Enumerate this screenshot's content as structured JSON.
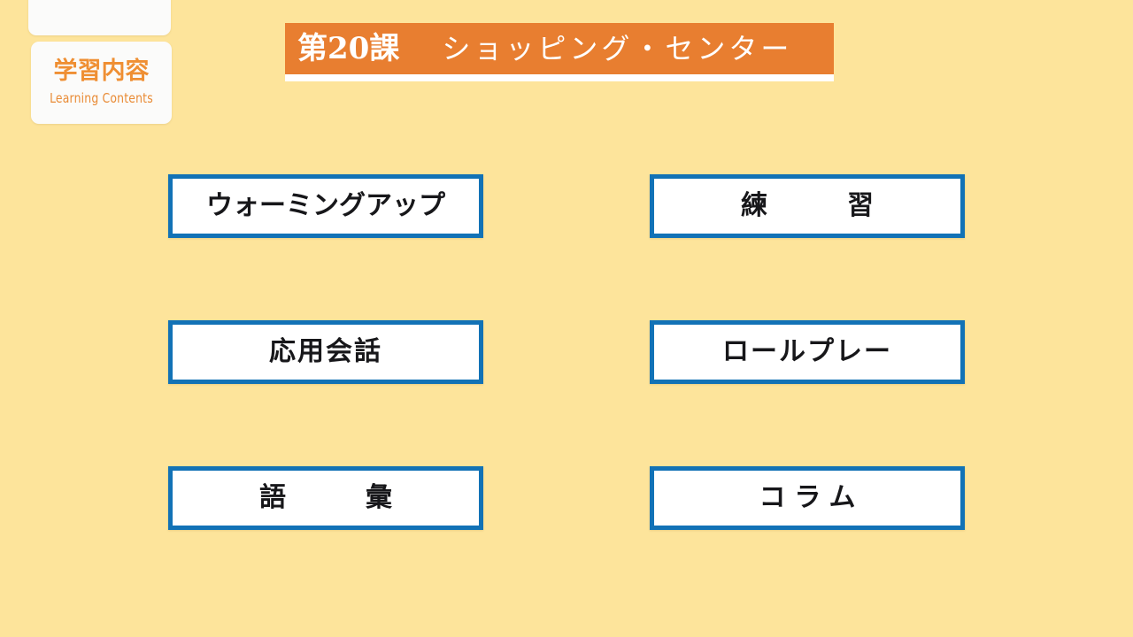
{
  "slide": {
    "background_color": "#fde49b",
    "accent_orange": "#e87e30",
    "accent_blue": "#1272b6",
    "card_background": "#fbfbfa",
    "text_color": "#17171a"
  },
  "sidebar": {
    "cards": [
      {
        "id": "blank",
        "label": ""
      },
      {
        "id": "learning-contents",
        "title_ja": "学習内容",
        "title_en": "Learning Contents"
      }
    ]
  },
  "header": {
    "lesson_number": "第20課",
    "lesson_title": "ショッピング・センター"
  },
  "contents": {
    "items": [
      {
        "id": "warming-up",
        "label": "ウォーミングアップ",
        "spacing": "normal"
      },
      {
        "id": "practice",
        "label": "練　　習",
        "spacing": "extra-wide"
      },
      {
        "id": "applied-conversation",
        "label": "応用会話",
        "spacing": "wide"
      },
      {
        "id": "role-play",
        "label": "ロールプレー",
        "spacing": "wide"
      },
      {
        "id": "vocabulary",
        "label": "語　　彙",
        "spacing": "extra-wide"
      },
      {
        "id": "column",
        "label": "コラム",
        "spacing": "extra-wide"
      }
    ]
  }
}
